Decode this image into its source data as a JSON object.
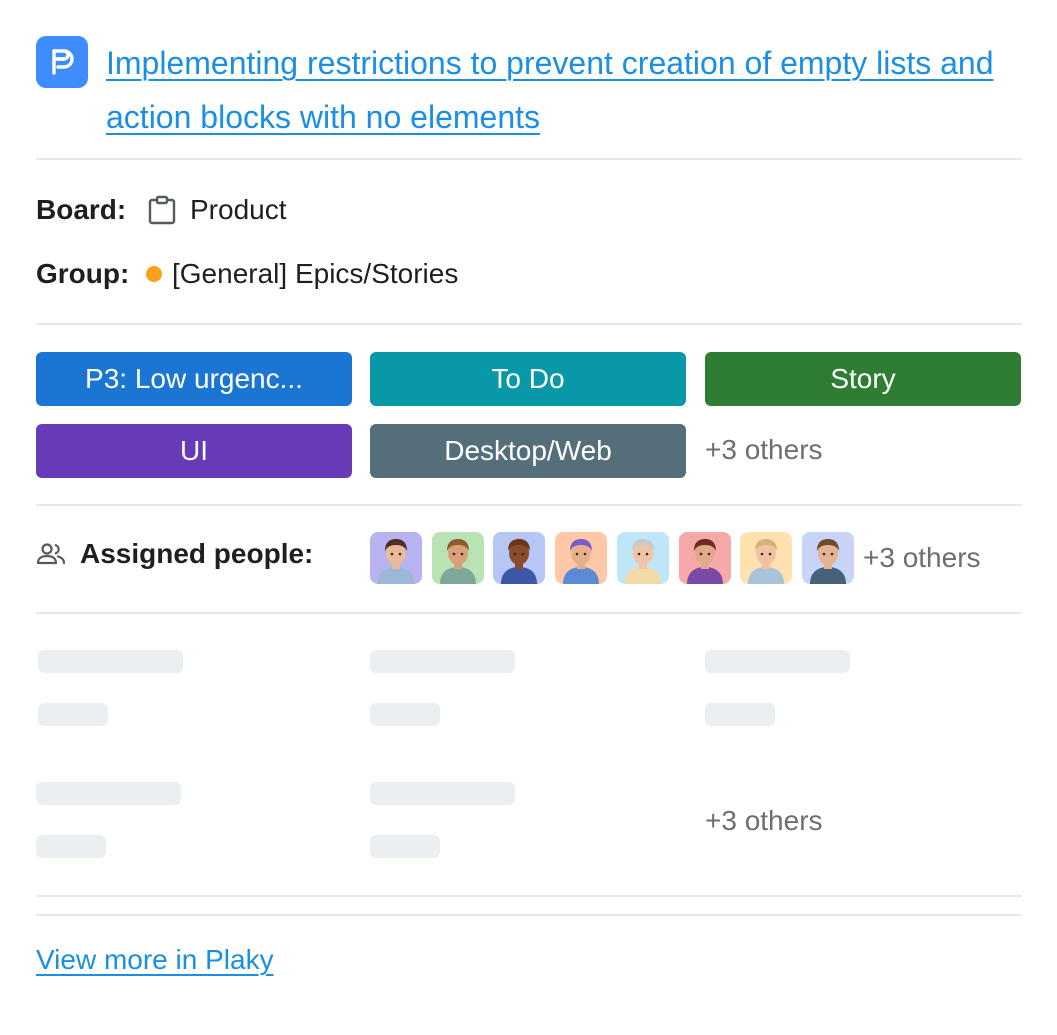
{
  "header": {
    "logo_icon": "plaky-logo-icon",
    "title": "Implementing restrictions to prevent creation of empty lists and action blocks with no elements"
  },
  "meta": {
    "board_label": "Board:",
    "board_icon": "clipboard-icon",
    "board_value": "Product",
    "group_label": "Group:",
    "group_dot_color": "#ff9f1a",
    "group_value": "[General] Epics/Stories"
  },
  "tags": [
    {
      "label": "P3: Low urgenc...",
      "color": "#1a76d2"
    },
    {
      "label": "To Do",
      "color": "#0998a8"
    },
    {
      "label": "Story",
      "color": "#2e7d32"
    },
    {
      "label": "UI",
      "color": "#673ab7"
    },
    {
      "label": "Desktop/Web",
      "color": "#546e7a"
    }
  ],
  "tags_more": "+3 others",
  "assigned": {
    "icon": "people-icon",
    "label": "Assigned people:",
    "avatars": [
      {
        "bg": "#b6b3f0",
        "skin": "#e9b99a",
        "hair": "#4a2f24",
        "shirt": "#9bb8d6"
      },
      {
        "bg": "#b9e3b4",
        "skin": "#d9a07a",
        "hair": "#8a5a2a",
        "shirt": "#7fa89a"
      },
      {
        "bg": "#b7c6f6",
        "skin": "#8a4b2a",
        "hair": "#6b3618",
        "shirt": "#3e57a6"
      },
      {
        "bg": "#ffc9a8",
        "skin": "#e8b08a",
        "hair": "#7a5bd1",
        "shirt": "#5d8ad6"
      },
      {
        "bg": "#bfe6f7",
        "skin": "#f0c4a4",
        "hair": "#c9c9c9",
        "shirt": "#f3d9a6"
      },
      {
        "bg": "#f7a8a8",
        "skin": "#e2a98a",
        "hair": "#6b2d1e",
        "shirt": "#7b4aa8"
      },
      {
        "bg": "#ffe2b0",
        "skin": "#efc2a3",
        "hair": "#d9b07a",
        "shirt": "#a9c4d9"
      },
      {
        "bg": "#c7d3f7",
        "skin": "#e7b291",
        "hair": "#6b4a2e",
        "shirt": "#46627a"
      }
    ],
    "more": "+3 others"
  },
  "fields_more": "+3 others",
  "footer": {
    "link_label": "View more in Plaky"
  }
}
